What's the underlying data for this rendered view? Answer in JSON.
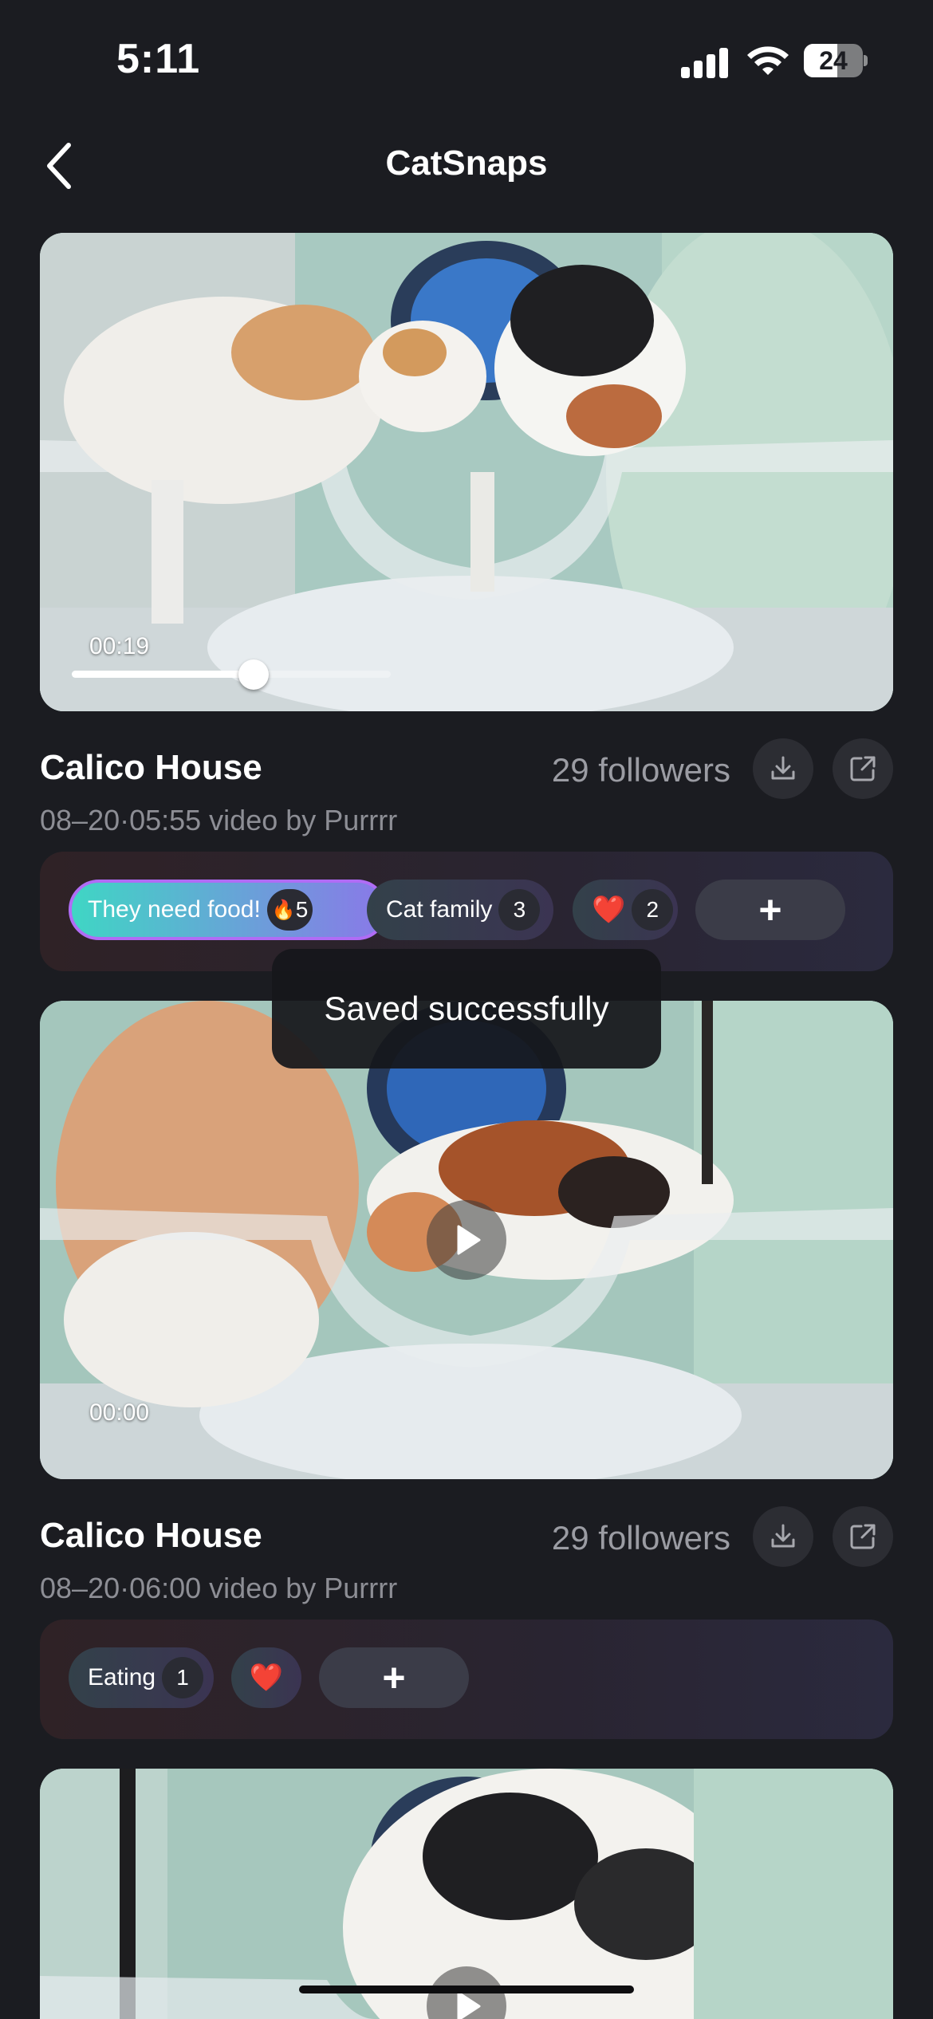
{
  "status_bar": {
    "time": "5:11",
    "battery": "24"
  },
  "nav": {
    "title": "CatSnaps"
  },
  "posts": [
    {
      "timecode": "00:19",
      "progress": 0.57,
      "house": "Calico House",
      "followers": "29 followers",
      "date_line": "08–20·05:55 video by Purrrr",
      "tags": [
        {
          "label": "They need food!",
          "emoji": "🔥",
          "count": "5",
          "style": "active"
        },
        {
          "label": "Cat family",
          "count": "3",
          "style": "dark"
        },
        {
          "emoji": "❤️",
          "count": "2",
          "style": "dark"
        }
      ],
      "add_label": "+"
    },
    {
      "timecode": "00:00",
      "house": "Calico House",
      "followers": "29 followers",
      "date_line": "08–20·06:00 video by Purrrr",
      "tags": [
        {
          "label": "Eating",
          "count": "1",
          "style": "dark"
        },
        {
          "emoji": "❤️",
          "style": "dark"
        }
      ],
      "add_label": "+"
    }
  ],
  "toast": {
    "text": "Saved successfully"
  },
  "colors": {
    "background": "#1b1c21",
    "accent_start": "#3fd6c4",
    "accent_end": "#8a78e8",
    "muted_text": "#9b9ca3"
  },
  "icons": [
    "chevron-left-icon",
    "download-icon",
    "share-icon",
    "play-icon",
    "signal-icon",
    "wifi-icon",
    "battery-icon"
  ]
}
